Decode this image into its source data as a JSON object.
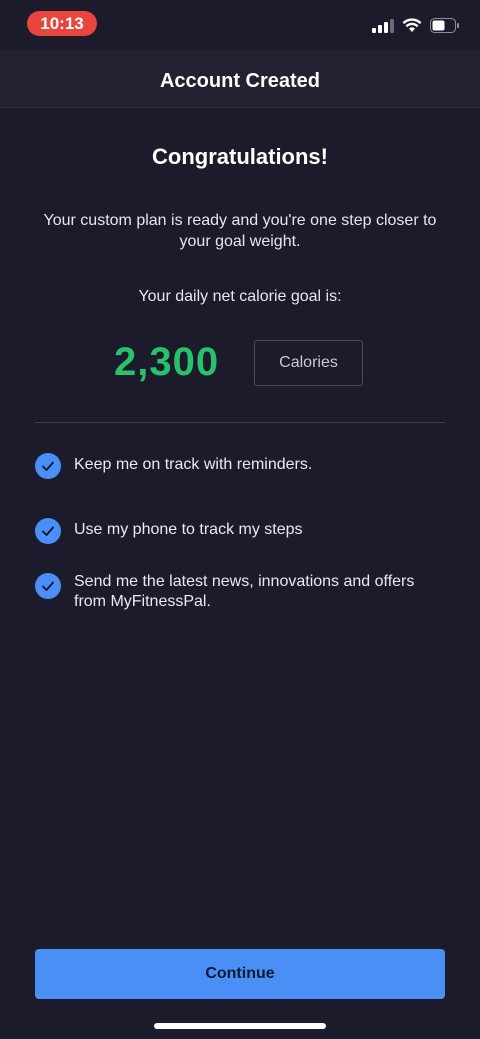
{
  "status_bar": {
    "time": "10:13"
  },
  "header": {
    "title": "Account Created"
  },
  "main": {
    "headline": "Congratulations!",
    "plan_message": "Your custom plan is ready and you're one step closer to your goal weight.",
    "goal_label": "Your daily net calorie goal is:",
    "calorie_goal": "2,300",
    "calorie_unit": "Calories",
    "options": [
      {
        "label": "Keep me on track with reminders.",
        "checked": true
      },
      {
        "label": "Use my phone to track my steps",
        "checked": true
      },
      {
        "label": "Send me the latest news, innovations and offers from MyFitnessPal.",
        "checked": true
      }
    ]
  },
  "footer": {
    "continue_label": "Continue"
  },
  "colors": {
    "background": "#1b1b2b",
    "accent": "#4a8ff5",
    "calorie_green": "#27c26a",
    "time_pill": "#e8453c"
  }
}
